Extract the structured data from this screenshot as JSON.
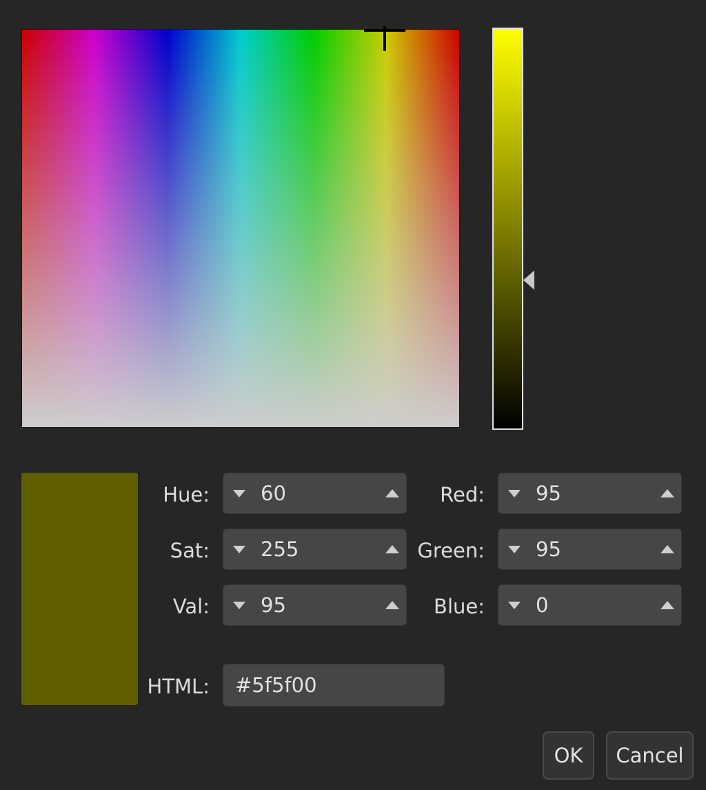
{
  "dialog": {
    "current_color": "#5f5f00"
  },
  "fields": {
    "hue": {
      "label": "Hue:",
      "value": "60"
    },
    "sat": {
      "label": "Sat:",
      "value": "255"
    },
    "val": {
      "label": "Val:",
      "value": "95"
    },
    "red": {
      "label": "Red:",
      "value": "95"
    },
    "green": {
      "label": "Green:",
      "value": "95"
    },
    "blue": {
      "label": "Blue:",
      "value": "0"
    },
    "html": {
      "label": "HTML:",
      "value": "#5f5f00"
    }
  },
  "buttons": {
    "ok": "OK",
    "cancel": "Cancel"
  },
  "picker": {
    "value_level_fraction": 0.373
  }
}
